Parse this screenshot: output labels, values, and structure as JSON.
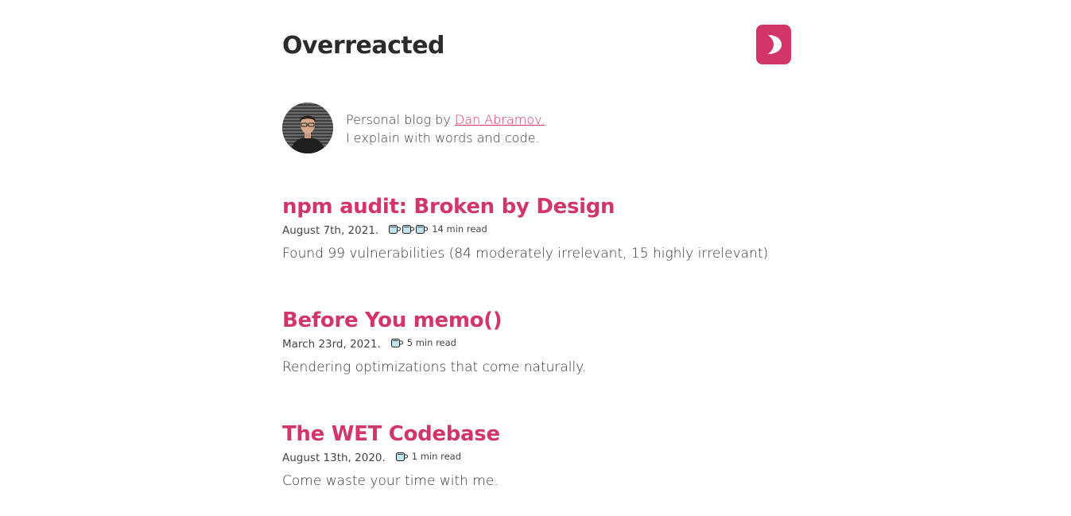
{
  "site": {
    "title": "Overreacted",
    "toggle_icon": "moon-icon",
    "accent_color": "#d23669"
  },
  "bio": {
    "prefix": "Personal blog by ",
    "author": "Dan Abramov.",
    "tagline": "I explain with words and code.",
    "avatar_icon": "avatar-photo"
  },
  "posts": [
    {
      "title": "npm audit: Broken by Design",
      "date": "August 7th, 2021.",
      "cups": 3,
      "read_time": "14 min read",
      "description": "Found 99 vulnerabilities (84 moderately irrelevant, 15 highly irrelevant)"
    },
    {
      "title": "Before You memo()",
      "date": "March 23rd, 2021.",
      "cups": 1,
      "read_time": "5 min read",
      "description": "Rendering optimizations that come naturally."
    },
    {
      "title": "The WET Codebase",
      "date": "August 13th, 2020.",
      "cups": 1,
      "read_time": "1 min read",
      "description": "Come waste your time with me."
    }
  ]
}
